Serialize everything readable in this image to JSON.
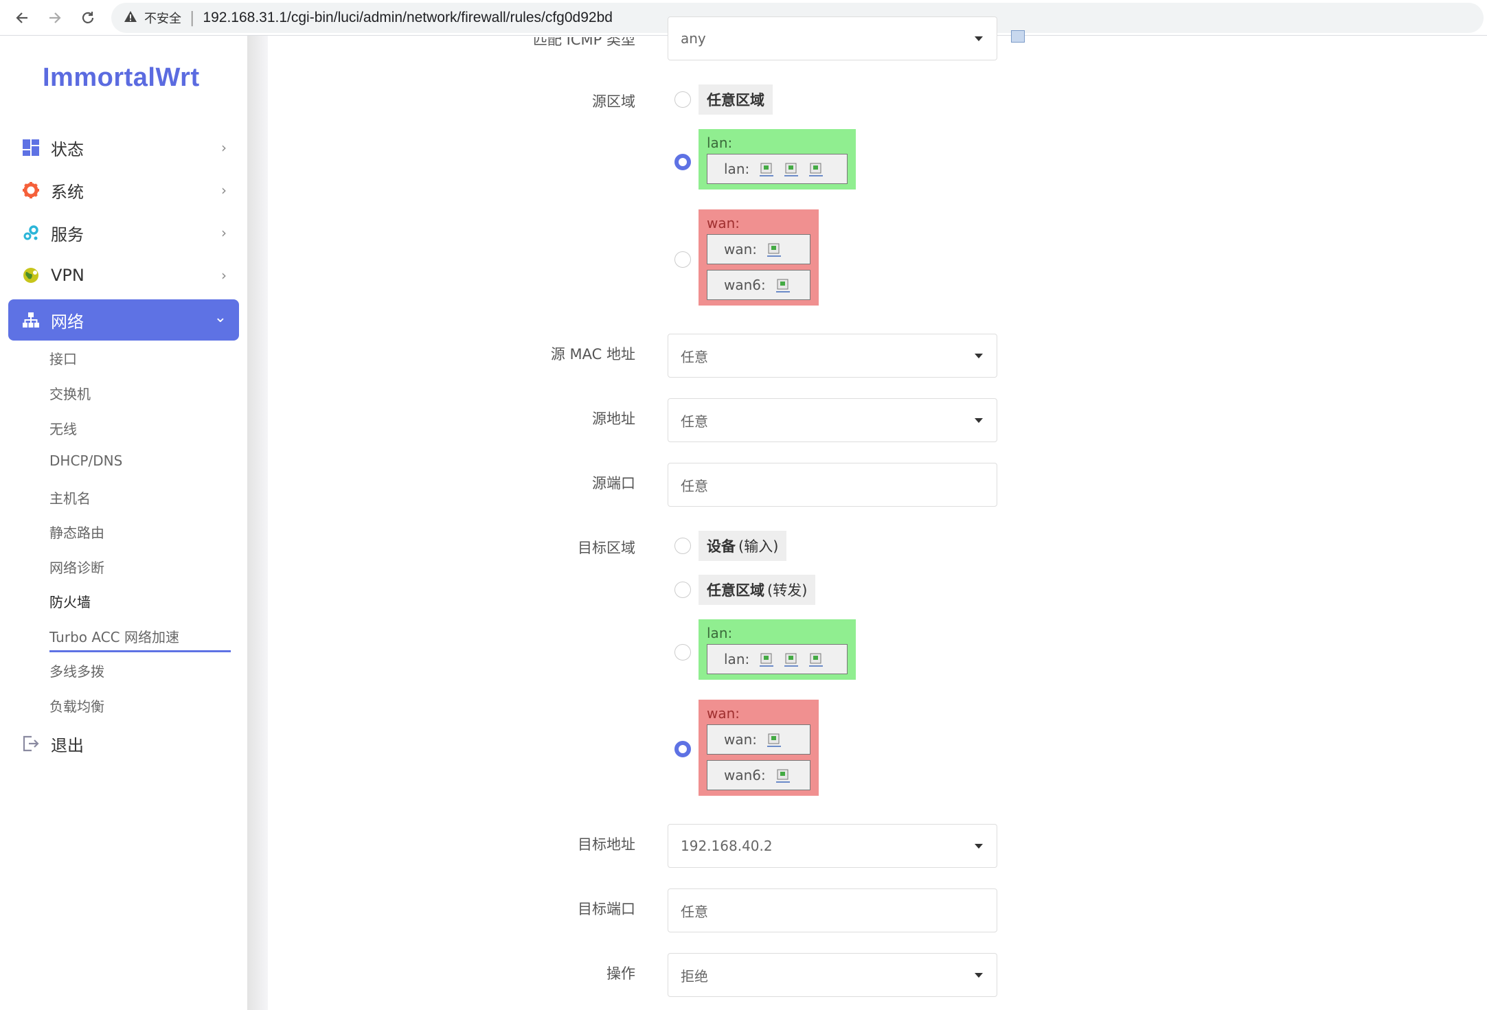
{
  "browser": {
    "security_label": "不安全",
    "url": "192.168.31.1/cgi-bin/luci/admin/network/firewall/rules/cfg0d92bd"
  },
  "sidebar": {
    "logo": "ImmortalWrt",
    "menu": [
      {
        "label": "状态",
        "icon": "dashboard-icon"
      },
      {
        "label": "系统",
        "icon": "gear-icon"
      },
      {
        "label": "服务",
        "icon": "services-gears-icon"
      },
      {
        "label": "VPN",
        "icon": "globe-icon"
      },
      {
        "label": "网络",
        "icon": "sitemap-icon",
        "active": true
      }
    ],
    "sub": [
      "接口",
      "交换机",
      "无线",
      "DHCP/DNS",
      "主机名",
      "静态路由",
      "网络诊断",
      "防火墙",
      "Turbo ACC 网络加速",
      "多线多拨",
      "负载均衡"
    ],
    "current_sub": "防火墙",
    "logout": "退出"
  },
  "form": {
    "icmp_label_partial": "匹配 ICMP 类型",
    "icmp_value": "any",
    "src_zone_label": "源区域",
    "any_zone": "任意区域",
    "lan_title": "lan:",
    "lan_dev": "lan:",
    "wan_title": "wan:",
    "wan_dev": "wan:",
    "wan6_dev": "wan6:",
    "src_mac_label": "源 MAC 地址",
    "src_mac_value": "任意",
    "src_addr_label": "源地址",
    "src_addr_value": "任意",
    "src_port_label": "源端口",
    "src_port_value": "任意",
    "dest_zone_label": "目标区域",
    "device_bold": "设备",
    "device_note": "(输入)",
    "any_zone_bold": "任意区域",
    "any_zone_note": "(转发)",
    "dest_addr_label": "目标地址",
    "dest_addr_value": "192.168.40.2",
    "dest_port_label": "目标端口",
    "dest_port_value": "任意",
    "action_label": "操作",
    "action_value": "拒绝"
  },
  "colors": {
    "accent": "#5e72e4",
    "lan_zone": "#90ee90",
    "wan_zone": "#f09090"
  }
}
